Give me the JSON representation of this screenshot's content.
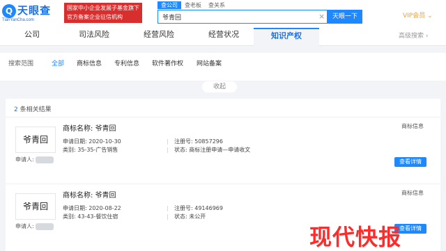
{
  "header": {
    "logo_mark": "Q",
    "logo_text": "天眼查",
    "logo_sub": "TianYanCha.com",
    "banner_line1": "国家中小企业发展子基金旗下",
    "banner_line2": "官方备案企业征信机构",
    "search_tabs": [
      "查公司",
      "查老板",
      "查关系"
    ],
    "search_value": "爷青回",
    "search_button": "天眼一下",
    "vip_label": "VIP会员 ⌄"
  },
  "nav": {
    "items": [
      "公司",
      "司法风险",
      "经营风险",
      "经营状况",
      "知识产权"
    ],
    "active": "知识产权",
    "advanced_search": "高级搜索 ›"
  },
  "filter": {
    "label": "搜索范围",
    "items": [
      "全部",
      "商标信息",
      "专利信息",
      "软件著作权",
      "网站备案"
    ],
    "active": "全部",
    "collapse": "收起"
  },
  "results": {
    "count": "2",
    "count_suffix": " 条相关结果",
    "items": [
      {
        "thumb": "爷青回",
        "name_label": "商标名称:",
        "name": "爷青回",
        "apply_date_label": "申请日期:",
        "apply_date": "2020-10-30",
        "reg_no_label": "注册号:",
        "reg_no": "50857296",
        "category_label": "类别:",
        "category": "35-35-广告销售",
        "status_label": "状态:",
        "status": "商标注册申请—申请收文",
        "applicant_label": "申请人:",
        "type_tag": "商标信息",
        "detail_button": "查看详情"
      },
      {
        "thumb": "爷青回",
        "name_label": "商标名称:",
        "name": "爷青回",
        "apply_date_label": "申请日期:",
        "apply_date": "2020-08-22",
        "reg_no_label": "注册号:",
        "reg_no": "49146969",
        "category_label": "类别:",
        "category": "43-43-餐饮住宿",
        "status_label": "状态:",
        "status": "未公开",
        "applicant_label": "申请人:",
        "type_tag": "商标信息",
        "detail_button": "查看详情"
      }
    ]
  },
  "watermark": "现代快报",
  "colors": {
    "accent": "#1e88ff",
    "banner": "#d92e2e",
    "vip": "#f39c34",
    "watermark": "#ff2a2a"
  }
}
